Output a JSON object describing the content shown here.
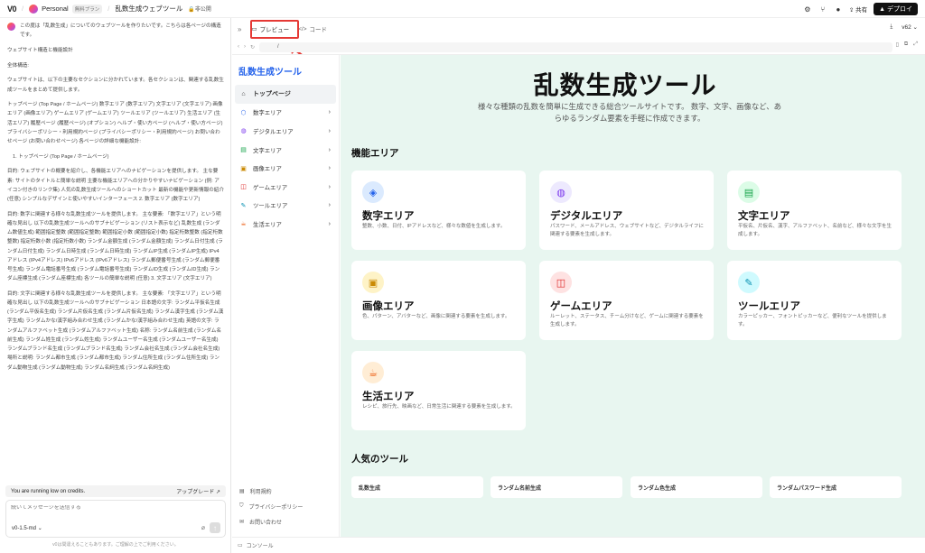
{
  "topbar": {
    "logo": "V0",
    "workspace": "Personal",
    "plan_badge": "無料プラン",
    "project_title": "乱数生成ウェブツール",
    "visibility": "非公開",
    "share": "共有",
    "deploy": "デプロイ"
  },
  "chat": {
    "paragraphs": [
      "この度は「乱数生成」についてのウェブツールを作りたいです。こちらは各ページの構造です。",
      "ウェブサイト構造と機能設計",
      "全体構造:",
      "ウェブサイトは、以下の主要なセクションに分かれています。各セクションは、関連する乱数生成ツールをまとめて提供します。",
      "トップページ (Top Page / ホームページ) 数字エリア (数字エリア) 文字エリア (文字エリア) 画像エリア (画像エリア) ゲームエリア (ゲームエリア) ツールエリア (ツールエリア) 生活エリア (生活エリア) 履歴ページ (履歴ページ) (オプション) ヘルプ・使い方ページ (ヘルプ・使い方ページ) プライバシーポリシー・利用規約ページ (プライバシーポリシー・利用規約ページ) お問い合わせページ (お問い合わせページ) 各ページの詳細な機能設計:"
    ],
    "list_item": "1. トップページ (Top Page / ホームページ)",
    "paragraphs2": [
      "目的: ウェブサイトの概要を紹介し、各機能エリアへのナビゲーションを提供します。 主な要素: サイトのタイトルと簡単な説明 主要な機能エリアへの分かりやすいナビゲーション (例: アイコン付きのリンク集) 人気の乱数生成ツールへのショートカット 最新の機能や更新情報の紹介 (任意) シンプルなデザインと使いやすいインターフェース 2. 数字エリア (数字エリア)",
      "目的: 数字に関連する様々な乱数生成ツールを提供します。 主な要素: 「数字エリア」という明確な見出し 以下の乱数生成ツールへのサブナビゲーション (リスト表示など) 乱数生成 (ランダム数値生成) 範囲指定整数 (範囲指定整数) 範囲指定小数 (範囲指定小数) 指定桁数整数 (指定桁数整数) 指定桁数小数 (指定桁数小数) ランダム金額生成 (ランダム金額生成) ランダム日付生成 (ランダム日付生成) ランダム日時生成 (ランダム日時生成) ランダムIP生成 (ランダムIP生成) IPv4アドレス (IPv4アドレス) IPv6アドレス (IPv6アドレス) ランダム郵便番号生成 (ランダム郵便番号生成) ランダム電話番号生成 (ランダム電話番号生成) ランダムID生成 (ランダムID生成) ランダム座標生成 (ランダム座標生成) 各ツールの簡単な説明 (任意) 3. 文字エリア (文字エリア)",
      "目的: 文字に関連する様々な乱数生成ツールを提供します。 主な要素: 「文字エリア」という明確な見出し 以下の乱数生成ツールへのサブナビゲーション 日本語の文字: ランダム平仮名生成 (ランダム平仮名生成) ランダム片仮名生成 (ランダム片仮名生成) ランダム漢字生成 (ランダム漢字生成) ランダムかな/漢字組み合わせ生成 (ランダムかな/漢字組み合わせ生成) 英語の文字: ランダムアルファベット生成 (ランダムアルファベット生成) 名称: ランダム名前生成 (ランダム名前生成) ランダム姓生成 (ランダム姓生成) ランダムユーザー名生成 (ランダムユーザー名生成) ランダムブランド名生成 (ランダムブランド名生成) ランダム会社名生成 (ランダム会社名生成) 場所と説明: ランダム都市生成 (ランダム都市生成) ランダム住所生成 (ランダム住所生成) ランダム動物生成 (ランダム動物生成) ランダム名詞生成 (ランダム名詞生成)"
    ],
    "credits_text": "You are running low on credits.",
    "upgrade": "アップグレード",
    "input_placeholder": "続いてメッセージを送信する",
    "model": "v0-1.5-md",
    "disclaimer": "v0は間違えることもあります。ご理解の上でご利用ください。"
  },
  "preview": {
    "tab_preview": "プレビュー",
    "tab_code": "コード",
    "version": "v62",
    "url": "/",
    "console": "コンソール",
    "highlight_color": "#e53935"
  },
  "site": {
    "sidebar_title": "乱数生成ツール",
    "nav": [
      {
        "label": "トップページ",
        "icon": "home-icon",
        "color": "#333"
      },
      {
        "label": "数字エリア",
        "icon": "hash-icon",
        "color": "#2563eb"
      },
      {
        "label": "デジタルエリア",
        "icon": "globe-icon",
        "color": "#7c3aed"
      },
      {
        "label": "文字エリア",
        "icon": "text-icon",
        "color": "#16a34a"
      },
      {
        "label": "画像エリア",
        "icon": "image-icon",
        "color": "#ca8a04"
      },
      {
        "label": "ゲームエリア",
        "icon": "gamepad-icon",
        "color": "#dc2626"
      },
      {
        "label": "ツールエリア",
        "icon": "wrench-icon",
        "color": "#0891b2"
      },
      {
        "label": "生活エリア",
        "icon": "coffee-icon",
        "color": "#ea580c"
      }
    ],
    "footer_links": [
      "利用規約",
      "プライバシーポリシー",
      "お問い合わせ"
    ],
    "hero_title": "乱数生成ツール",
    "hero_desc": "様々な種類の乱数を簡単に生成できる総合ツールサイトです。 数字、文字、画像など、あらゆるランダム要素を手軽に作成できます。",
    "features_title": "機能エリア",
    "cards": [
      {
        "title": "数字エリア",
        "desc": "整数、小数、日付、IPアドレスなど、様々な数値を生成します。",
        "icon": "shapes-icon",
        "color": "#2563eb",
        "bg": "#dbeafe"
      },
      {
        "title": "デジタルエリア",
        "desc": "パスワード、メールアドレス、ウェブサイトなど、デジタルライフに関連する要素を生成します。",
        "icon": "globe-icon",
        "color": "#7c3aed",
        "bg": "#ede9fe"
      },
      {
        "title": "文字エリア",
        "desc": "平仮名、片仮名、漢字、アルファベット、名前など、様々な文字を生成します。",
        "icon": "document-icon",
        "color": "#16a34a",
        "bg": "#dcfce7"
      },
      {
        "title": "画像エリア",
        "desc": "色、パターン、アバターなど、画像に関連する要素を生成します。",
        "icon": "image-icon",
        "color": "#ca8a04",
        "bg": "#fef3c7"
      },
      {
        "title": "ゲームエリア",
        "desc": "ルーレット、ステータス、チーム分けなど、ゲームに関連する要素を生成します。",
        "icon": "gamepad-icon",
        "color": "#dc2626",
        "bg": "#fee2e2"
      },
      {
        "title": "ツールエリア",
        "desc": "カラーピッカー、フォントピッカーなど、便利なツールを提供します。",
        "icon": "wrench-icon",
        "color": "#0891b2",
        "bg": "#cffafe"
      },
      {
        "title": "生活エリア",
        "desc": "レシピ、旅行先、映画など、日常生活に関連する要素を生成します。",
        "icon": "coffee-icon",
        "color": "#ea580c",
        "bg": "#ffedd5"
      }
    ],
    "popular_title": "人気のツール",
    "popular": [
      "乱数生成",
      "ランダム名前生成",
      "ランダム色生成",
      "ランダムパスワード生成"
    ]
  }
}
